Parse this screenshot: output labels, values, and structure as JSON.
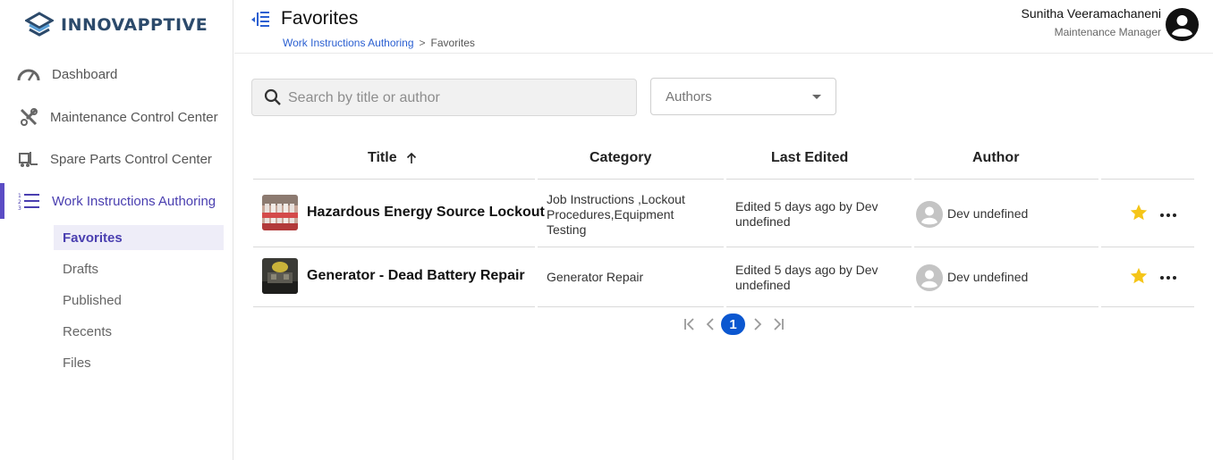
{
  "brand": {
    "name": "INNOVAPPTIVE",
    "color": "#2c4a6b"
  },
  "sidebar": {
    "items": [
      {
        "label": "Dashboard",
        "icon": "speedometer-icon"
      },
      {
        "label": "Maintenance Control Center",
        "icon": "tools-icon"
      },
      {
        "label": "Spare Parts Control Center",
        "icon": "forklift-icon"
      },
      {
        "label": "Work Instructions Authoring",
        "icon": "numbered-list-icon",
        "active": true
      }
    ],
    "subitems": [
      {
        "label": "Favorites",
        "selected": true
      },
      {
        "label": "Drafts"
      },
      {
        "label": "Published"
      },
      {
        "label": "Recents"
      },
      {
        "label": "Files"
      }
    ]
  },
  "header": {
    "title": "Favorites",
    "breadcrumb": {
      "parent": "Work Instructions Authoring",
      "separator": ">",
      "current": "Favorites"
    },
    "user": {
      "name": "Sunitha Veeramachaneni",
      "role": "Maintenance Manager"
    }
  },
  "filters": {
    "search_placeholder": "Search by title or author",
    "authors_label": "Authors"
  },
  "table": {
    "columns": {
      "title": "Title",
      "category": "Category",
      "last_edited": "Last Edited",
      "author": "Author"
    },
    "sort": {
      "column": "Title",
      "direction": "ascending"
    },
    "rows": [
      {
        "title": "Hazardous Energy Source Lockout",
        "category": "Job Instructions ,Lockout Procedures,Equipment Testing",
        "last_edited": "Edited 5 days ago by Dev undefined",
        "author": "Dev undefined",
        "favorite": true
      },
      {
        "title": "Generator - Dead Battery Repair",
        "category": "Generator Repair",
        "last_edited": "Edited 5 days ago by Dev undefined",
        "author": "Dev undefined",
        "favorite": true
      }
    ]
  },
  "pagination": {
    "current_page": "1"
  },
  "colors": {
    "accent": "#5b4cc4",
    "link": "#2a5fd1",
    "page_active": "#0b57d0",
    "star": "#f5c518"
  }
}
